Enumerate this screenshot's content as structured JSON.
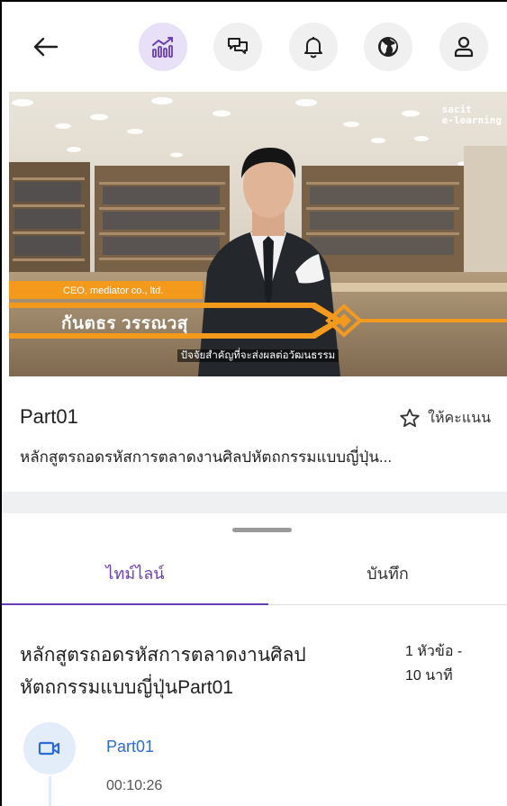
{
  "topbar": {
    "icons": [
      "back-arrow-icon",
      "analytics-icon",
      "chat-icon",
      "bell-icon",
      "globe-icon",
      "user-icon"
    ]
  },
  "video": {
    "brand_line1": "sacit",
    "brand_line2": "e-learning",
    "lower_third_title": "CEO, mediator co., ltd.",
    "lower_third_name": "กันตธร วรรณวสุ",
    "subtitle": "ปัจจัยสำคัญที่จะส่งผลต่อวัฒนธรรม",
    "accent_color": "#f39a1c"
  },
  "info": {
    "part_title": "Part01",
    "rate_label": "ให้คะแนน",
    "course_title": "หลักสูตรถอดรหัสการตลาดงานศิลปหัตถกรรมแบบญี่ปุ่น..."
  },
  "tabs": {
    "timeline": "ไทม์ไลน์",
    "notes": "บันทึก",
    "active_color": "#6a3fb5"
  },
  "section": {
    "title": "หลักสูตรถอดรหัสการตลาดงานศิลปหัตถกรรมแบบญี่ปุ่นPart01",
    "meta_line1": "1 หัวข้อ -",
    "meta_line2": "10 นาที"
  },
  "lesson": {
    "name": "Part01",
    "duration": "00:10:26",
    "icon": "video-camera-icon"
  }
}
